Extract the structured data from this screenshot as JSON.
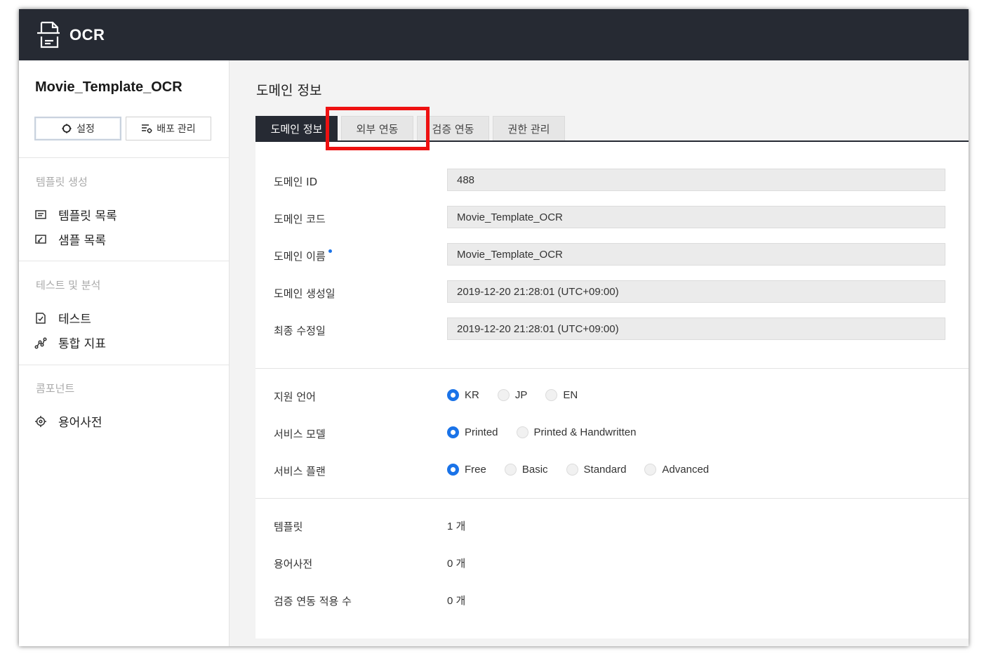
{
  "app": {
    "title": "OCR",
    "icon": "document-scan-icon"
  },
  "sidebar": {
    "project_name": "Movie_Template_OCR",
    "buttons": {
      "settings": "설정",
      "deploy": "배포 관리"
    },
    "sections": [
      {
        "title": "템플릿 생성",
        "items": [
          {
            "label": "템플릿 목록",
            "icon": "list-icon"
          },
          {
            "label": "샘플 목록",
            "icon": "image-edit-icon"
          }
        ]
      },
      {
        "title": "테스트 및 분석",
        "items": [
          {
            "label": "테스트",
            "icon": "check-doc-icon"
          },
          {
            "label": "통합 지표",
            "icon": "chart-nodes-icon"
          }
        ]
      },
      {
        "title": "콤포넌트",
        "items": [
          {
            "label": "용어사전",
            "icon": "target-icon"
          }
        ]
      }
    ]
  },
  "main": {
    "title": "도메인 정보",
    "tabs": [
      {
        "label": "도메인 정보",
        "active": true
      },
      {
        "label": "외부 연동",
        "active": false
      },
      {
        "label": "검증 연동",
        "active": false
      },
      {
        "label": "권한 관리",
        "active": false
      }
    ],
    "fields": [
      {
        "label": "도메인 ID",
        "value": "488",
        "required": false
      },
      {
        "label": "도메인 코드",
        "value": "Movie_Template_OCR",
        "required": false
      },
      {
        "label": "도메인 이름",
        "value": "Movie_Template_OCR",
        "required": true
      },
      {
        "label": "도메인 생성일",
        "value": "2019-12-20 21:28:01 (UTC+09:00)",
        "required": false
      },
      {
        "label": "최종 수정일",
        "value": "2019-12-20 21:28:01 (UTC+09:00)",
        "required": false
      }
    ],
    "options": [
      {
        "label": "지원 언어",
        "choices": [
          "KR",
          "JP",
          "EN"
        ],
        "selected": "KR"
      },
      {
        "label": "서비스 모델",
        "choices": [
          "Printed",
          "Printed & Handwritten"
        ],
        "selected": "Printed"
      },
      {
        "label": "서비스 플랜",
        "choices": [
          "Free",
          "Basic",
          "Standard",
          "Advanced"
        ],
        "selected": "Free"
      }
    ],
    "counts": [
      {
        "label": "템플릿",
        "value": "1 개"
      },
      {
        "label": "용어사전",
        "value": "0 개"
      },
      {
        "label": "검증 연동 적용 수",
        "value": "0 개"
      }
    ]
  },
  "colors": {
    "topbar": "#262a33",
    "accent": "#1a73e8",
    "highlight": "#ee1111"
  }
}
